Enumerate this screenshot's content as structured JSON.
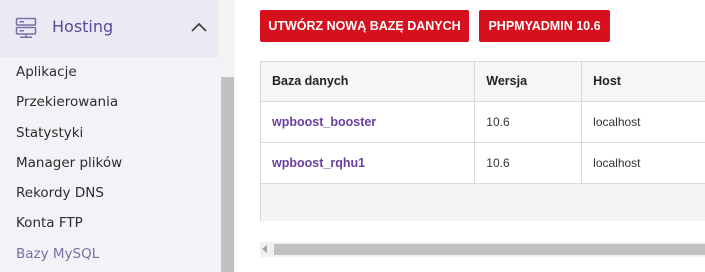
{
  "sidebar": {
    "section_title": "Hosting",
    "section_icon": "server-icon",
    "items": [
      {
        "label": "Aplikacje",
        "active": false
      },
      {
        "label": "Przekierowania",
        "active": false
      },
      {
        "label": "Statystyki",
        "active": false
      },
      {
        "label": "Manager plików",
        "active": false
      },
      {
        "label": "Rekordy DNS",
        "active": false
      },
      {
        "label": "Konta FTP",
        "active": false
      },
      {
        "label": "Bazy MySQL",
        "active": true
      }
    ]
  },
  "toolbar": {
    "new_db_label": "UTWÓRZ NOWĄ BAZĘ DANYCH",
    "phpmyadmin_label": "PHPMYADMIN 10.6"
  },
  "table": {
    "headers": [
      "Baza danych",
      "Wersja",
      "Host"
    ],
    "rows": [
      {
        "name": "wpboost_booster",
        "version": "10.6",
        "host": "localhost"
      },
      {
        "name": "wpboost_rqhu1",
        "version": "10.6",
        "host": "localhost"
      }
    ]
  },
  "colors": {
    "accent_red": "#d7101e",
    "link_purple": "#6b3fa0",
    "sidebar_active": "#7b6fa8",
    "sidebar_title": "#5a4a9a"
  }
}
